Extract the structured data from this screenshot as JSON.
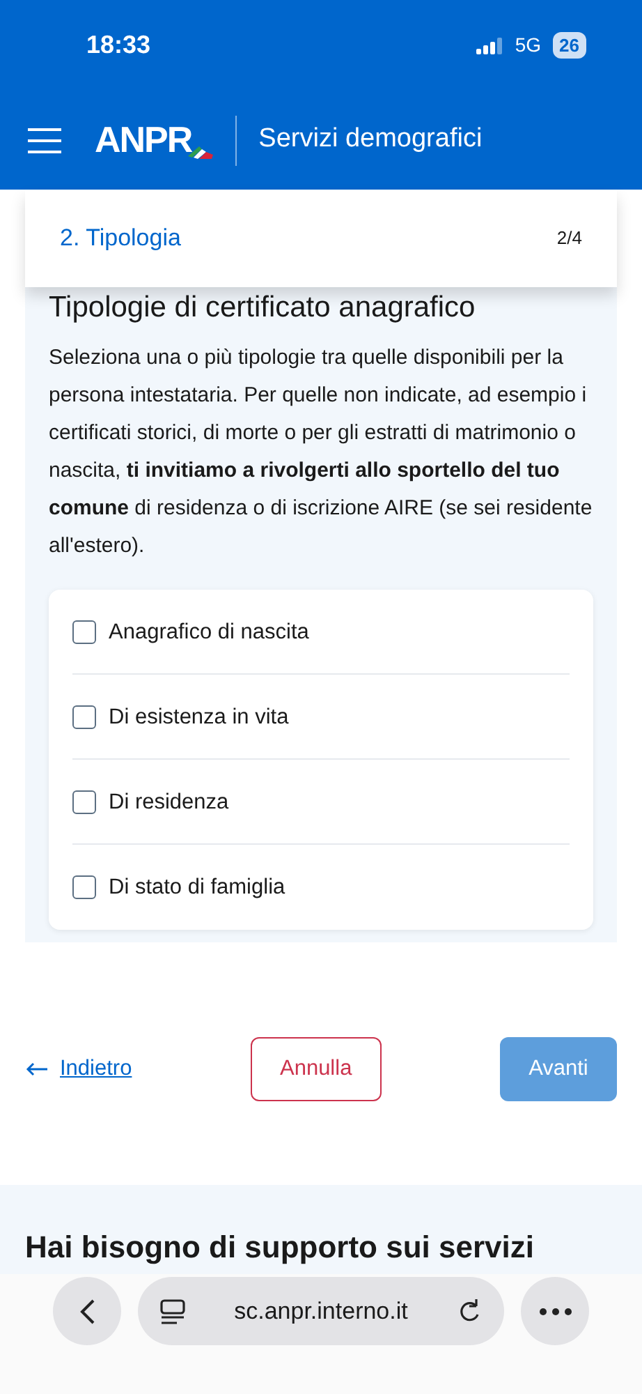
{
  "status_bar": {
    "time": "18:33",
    "network": "5G",
    "battery": "26"
  },
  "header": {
    "logo": "ANPR",
    "title": "Servizi demografici"
  },
  "step": {
    "label": "2. Tipologia",
    "counter": "2/4"
  },
  "section": {
    "title": "Tipologie di certificato anagrafico",
    "description": "Seleziona una o più tipologie tra quelle disponibili per la persona intestataria. Per quelle non indicate, ad esempio i certificati storici, di morte o per gli estratti di matrimonio o nascita, **ti invitiamo a rivolgerti allo sportello del tuo comune** di residenza o di iscrizione AIRE (se sei residente all'estero).",
    "options": [
      {
        "label": "Anagrafico di nascita",
        "checked": false
      },
      {
        "label": "Di esistenza in vita",
        "checked": false
      },
      {
        "label": "Di residenza",
        "checked": false
      },
      {
        "label": "Di stato di famiglia",
        "checked": false
      }
    ]
  },
  "actions": {
    "back": "Indietro",
    "cancel": "Annulla",
    "next": "Avanti",
    "next_disabled": true
  },
  "support": {
    "title": "Hai bisogno di supporto sui servizi"
  },
  "browser": {
    "url": "sc.anpr.interno.it"
  }
}
